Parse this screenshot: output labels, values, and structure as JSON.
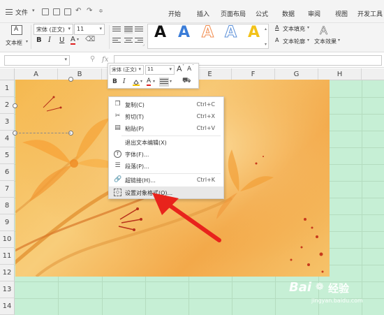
{
  "menubar": {
    "file_label": "文件",
    "tabs": [
      "开始",
      "插入",
      "页面布局",
      "公式",
      "数据",
      "审阅",
      "视图",
      "开发工具"
    ]
  },
  "ribbon": {
    "textbox_label": "文本框",
    "font_name": "宋体 (正文)",
    "font_size": "11",
    "bold": "B",
    "italic": "I",
    "underline": "U",
    "font_color_letter": "A",
    "wordart_letter": "A",
    "text_fill": "文本填充",
    "text_outline": "文本轮廓",
    "text_effect": "文本效果"
  },
  "formula_bar": {
    "fx": "fx"
  },
  "columns": [
    "A",
    "B",
    "C",
    "D",
    "E",
    "F",
    "G",
    "H"
  ],
  "rows": [
    "1",
    "2",
    "3",
    "4",
    "5",
    "6",
    "7",
    "8",
    "9",
    "10",
    "11",
    "12",
    "13",
    "14"
  ],
  "mini_toolbar": {
    "font_name": "宋体 (正文)",
    "font_size": "11",
    "grow": "A",
    "shrink": "A",
    "bold": "B",
    "italic": "I",
    "font_color": "A"
  },
  "context_menu": {
    "items": [
      {
        "label": "复制(C)",
        "shortcut": "Ctrl+C"
      },
      {
        "label": "剪切(T)",
        "shortcut": "Ctrl+X"
      },
      {
        "label": "粘贴(P)",
        "shortcut": "Ctrl+V"
      },
      {
        "label": "退出文本编辑(X)",
        "shortcut": ""
      },
      {
        "label": "字体(F)...",
        "shortcut": ""
      },
      {
        "label": "段落(P)...",
        "shortcut": ""
      },
      {
        "label": "超链接(H)...",
        "shortcut": "Ctrl+K"
      },
      {
        "label": "设置对象格式(O)...",
        "shortcut": ""
      }
    ]
  },
  "watermark": {
    "brand": "Bai",
    "brand2": "经验",
    "url": "jingyan.baidu.com"
  },
  "colors": {
    "sheet_fill": "#c6efd5",
    "arrow": "#e8231c",
    "wordart_black": "#111111",
    "wordart_blue": "#3b7dd8",
    "wordart_orange": "#f08a4b",
    "wordart_yellow": "#f2c21a"
  }
}
